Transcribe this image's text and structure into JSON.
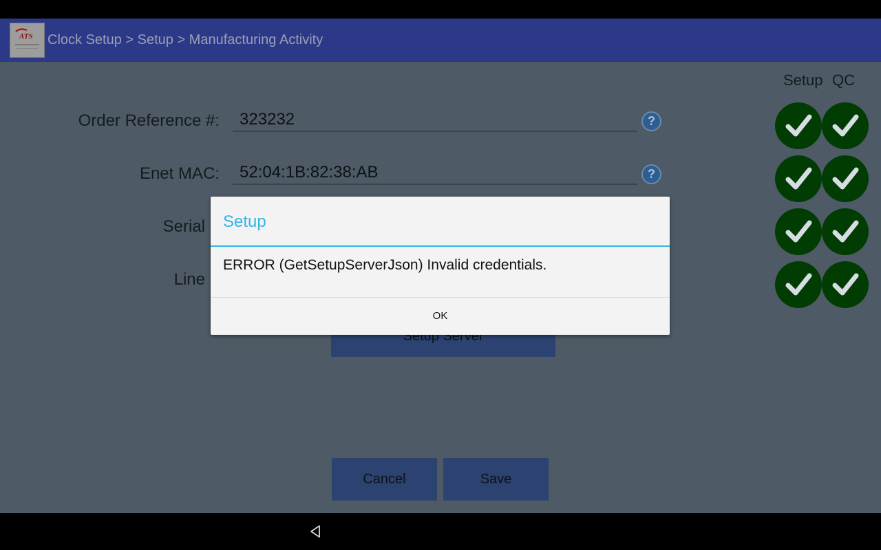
{
  "app_bar": {
    "breadcrumb": "Clock Setup > Setup > Manufacturing Activity",
    "logo_text": "ATS",
    "logo_icon": "company-logo"
  },
  "form": {
    "order_reference": {
      "label": "Order Reference #:",
      "value": "323232"
    },
    "enet_mac": {
      "label": "Enet MAC:",
      "value": "52:04:1B:82:38:AB"
    },
    "serial": {
      "label": "Serial"
    },
    "line": {
      "label": "Line"
    },
    "help_glyph": "?"
  },
  "status_columns": {
    "setup": "Setup",
    "qc": "QC",
    "rows": [
      {
        "setup": "checked",
        "qc": "checked"
      },
      {
        "setup": "checked",
        "qc": "checked"
      },
      {
        "setup": "checked",
        "qc": "checked"
      },
      {
        "setup": "checked",
        "qc": "checked"
      }
    ]
  },
  "buttons": {
    "setup_server": "Setup Server",
    "cancel": "Cancel",
    "save": "Save"
  },
  "dialog": {
    "title": "Setup",
    "message": "ERROR (GetSetupServerJson) Invalid credentials.",
    "ok": "OK"
  },
  "colors": {
    "accent": "#33b5e5",
    "app_bar": "#2c3989",
    "check_bg": "#013c03"
  },
  "nav": {
    "back_icon": "back-triangle-icon"
  }
}
